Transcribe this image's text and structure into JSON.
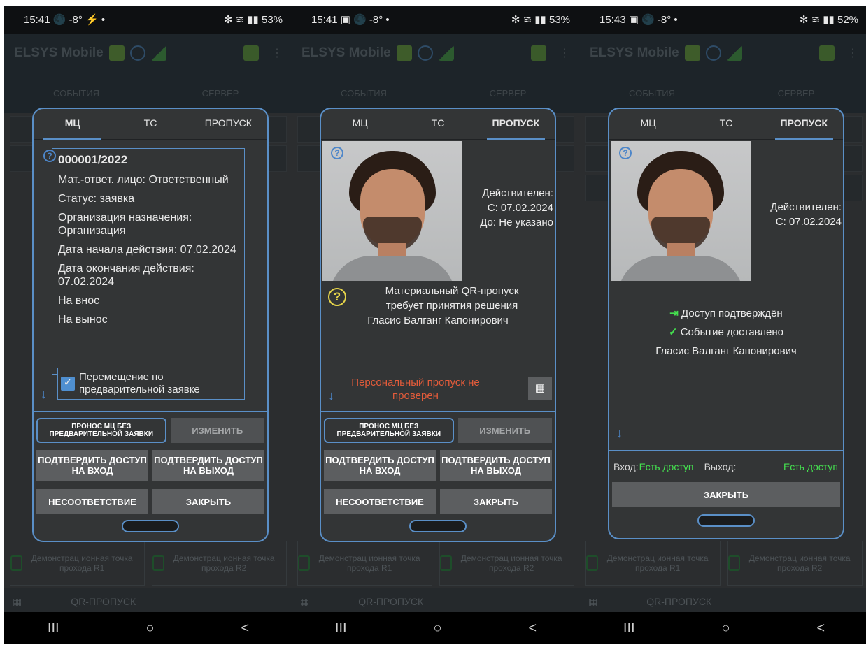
{
  "panels": [
    {
      "time": "15:41",
      "status_icons": "🌑 -8° ⚡ •",
      "status_right": "✻ ≋ ▮▮ 53%",
      "app_title": "ELSYS Mobile",
      "bg_tabs": [
        "СОБЫТИЯ",
        "СЕРВЕР"
      ],
      "bg_points": [
        "Демонстрац ионная точка прохода R1",
        "Демонстрац ионная точка прохода R2"
      ],
      "qr_label": "QR-ПРОПУСК",
      "nav": [
        "III",
        "○",
        "<"
      ],
      "dialog_tabs": [
        "МЦ",
        "ТС",
        "ПРОПУСК"
      ],
      "info": {
        "number": "000001/2022",
        "lines": [
          "Мат.-ответ. лицо: Ответственный",
          "Статус: заявка",
          "Организация назначения: Организация",
          "Дата начала действия: 07.02.2024",
          "Дата окончания действия: 07.02.2024",
          "На внос",
          "На вынос"
        ],
        "checkbox_label": "Перемещение по предварительной заявке"
      },
      "buttons": {
        "no_request": "ПРОНОС МЦ БЕЗ ПРЕДВАРИТЕЛЬНОЙ ЗАЯВКИ",
        "change": "ИЗМЕНИТЬ",
        "confirm_in": "ПОДТВЕРДИТЬ ДОСТУП НА ВХОД",
        "confirm_out": "ПОДТВЕРДИТЬ ДОСТУП НА ВЫХОД",
        "mismatch": "НЕСООТВЕТСТВИЕ",
        "close": "ЗАКРЫТЬ"
      }
    },
    {
      "time": "15:41",
      "status_icons": "▣ 🌑 -8° •",
      "status_right": "✻ ≋ ▮▮ 53%",
      "app_title": "ELSYS Mobile",
      "bg_tabs": [
        "СОБЫТИЯ",
        "СЕРВЕР"
      ],
      "bg_points": [
        "Демонстрац ионная точка прохода R1",
        "Демонстрац ионная точка прохода R2"
      ],
      "qr_label": "QR-ПРОПУСК",
      "nav": [
        "III",
        "○",
        "<"
      ],
      "dialog_tabs": [
        "МЦ",
        "ТС",
        "ПРОПУСК"
      ],
      "valid_lines": [
        "Действителен:",
        "С: 07.02.2024",
        "До: Не указано"
      ],
      "message_lines": [
        "Материальный QR-пропуск",
        "требует принятия решения",
        "Гласис Валганг Капонирович"
      ],
      "warning_lines": [
        "Персональный пропуск не",
        "проверен"
      ],
      "buttons": {
        "no_request": "ПРОНОС МЦ БЕЗ ПРЕДВАРИТЕЛЬНОЙ ЗАЯВКИ",
        "change": "ИЗМЕНИТЬ",
        "confirm_in": "ПОДТВЕРДИТЬ ДОСТУП НА ВХОД",
        "confirm_out": "ПОДТВЕРДИТЬ ДОСТУП НА ВЫХОД",
        "mismatch": "НЕСООТВЕТСТВИЕ",
        "close": "ЗАКРЫТЬ"
      }
    },
    {
      "time": "15:43",
      "status_icons": "▣ 🌑 -8° •",
      "status_right": "✻ ≋ ▮▮ 52%",
      "app_title": "ELSYS Mobile",
      "bg_tabs": [
        "СОБЫТИЯ",
        "СЕРВЕР"
      ],
      "bg_points": [
        "Демонстрац ионная точка прохода R1",
        "Демонстрац ионная точка прохода R2"
      ],
      "qr_label": "QR-ПРОПУСК",
      "nav": [
        "III",
        "○",
        "<"
      ],
      "dialog_tabs": [
        "МЦ",
        "ТС",
        "ПРОПУСК"
      ],
      "valid_lines": [
        "Действителен:",
        "С: 07.02.2024"
      ],
      "access_confirmed": "Доступ подтверждён",
      "event_delivered": "Событие доставлено",
      "person": "Гласис Валганг Капонирович",
      "entry_label": "Вход:",
      "exit_label": "Выход:",
      "entry_value": "Есть доступ",
      "exit_value": "Есть доступ",
      "close": "ЗАКРЫТЬ"
    }
  ],
  "colors": {
    "accent": "#5a8fc7",
    "ok": "#44e04f",
    "warn": "#e35b3a",
    "help": "#e6d44a"
  }
}
